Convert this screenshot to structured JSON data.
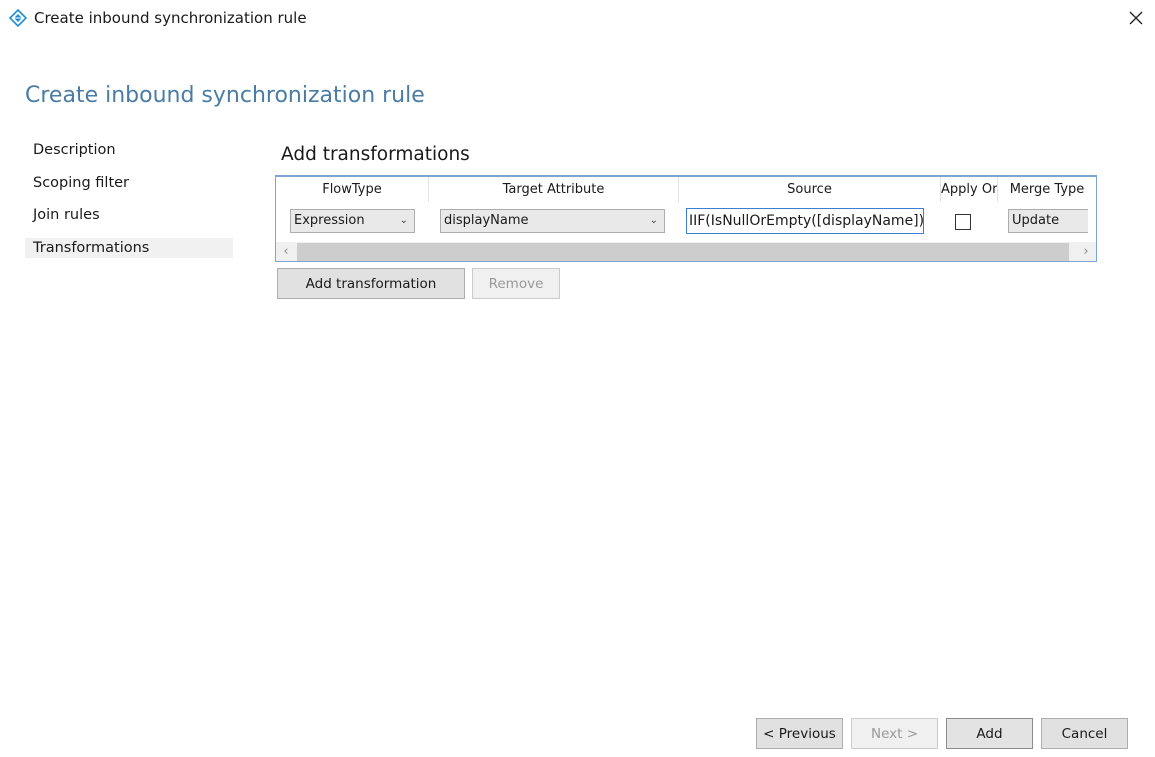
{
  "window": {
    "title": "Create inbound synchronization rule",
    "icon": "sync-rule-diamond-icon",
    "close_icon": "close-icon"
  },
  "page": {
    "title": "Create inbound synchronization rule"
  },
  "nav": {
    "items": [
      {
        "label": "Description"
      },
      {
        "label": "Scoping filter"
      },
      {
        "label": "Join rules"
      },
      {
        "label": "Transformations",
        "active": true
      }
    ]
  },
  "section": {
    "title": "Add transformations"
  },
  "grid": {
    "columns": [
      "FlowType",
      "Target Attribute",
      "Source",
      "Apply Or",
      "Merge Type"
    ],
    "rows": [
      {
        "flow_type": "Expression",
        "target_attribute": "displayName",
        "source": "IIF(IsNullOrEmpty([displayName]),[",
        "apply_once": false,
        "merge_type": "Update"
      }
    ],
    "scroll_left_icon": "chevron-left-icon",
    "scroll_right_icon": "chevron-right-icon"
  },
  "actions": {
    "add_transformation": "Add transformation",
    "remove": "Remove"
  },
  "footer": {
    "previous": "< Previous",
    "next": "Next >",
    "add": "Add",
    "cancel": "Cancel"
  },
  "colors": {
    "title_blue": "#4a7ca4",
    "grid_border": "#7aa5d4",
    "input_focus": "#3c7fd1",
    "icon_blue": "#1e8fd6"
  }
}
